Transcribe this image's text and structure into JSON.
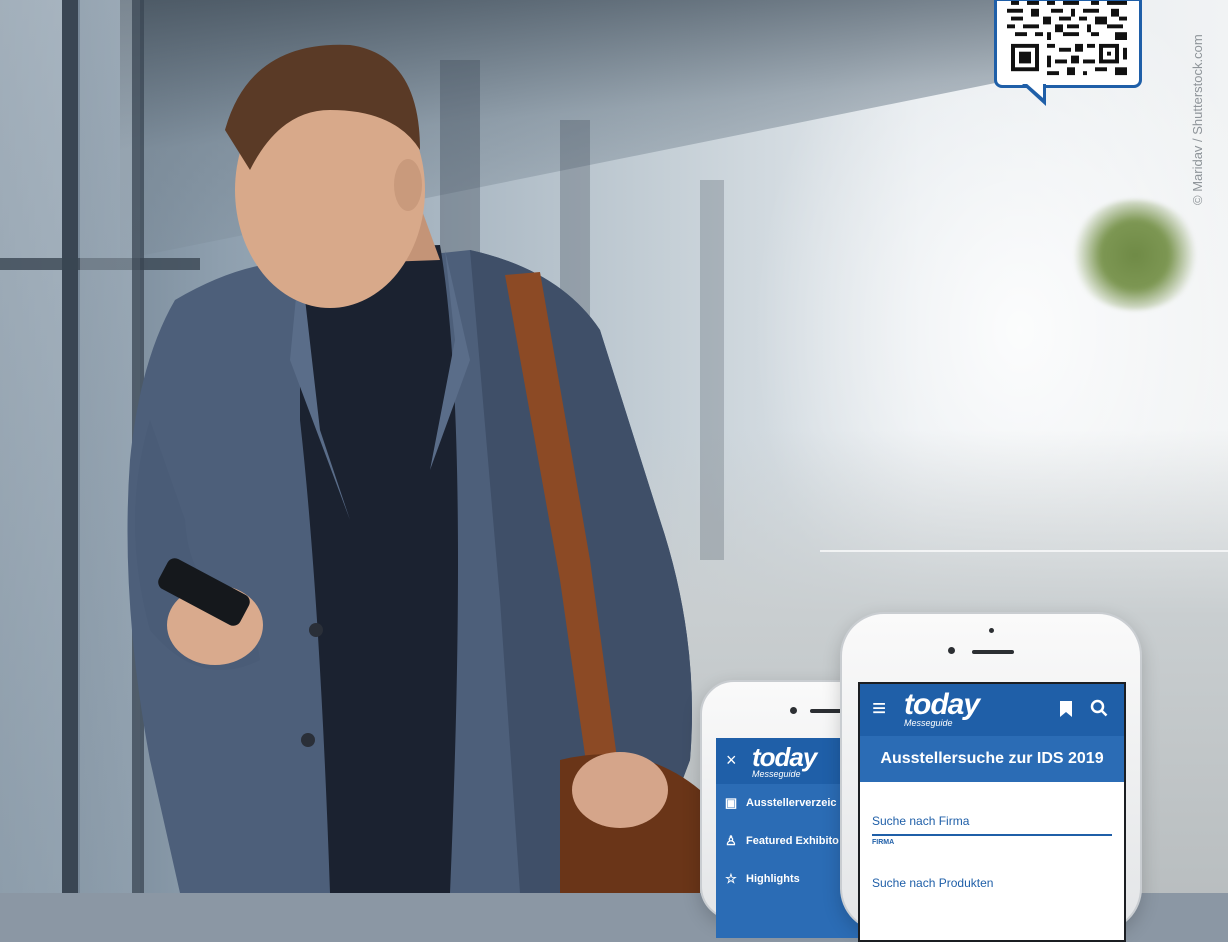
{
  "qr_code": {
    "label": "qr-code"
  },
  "photo_credit": "© Maridav / Shutterstock.com",
  "colors": {
    "brand_blue": "#1f5fa8",
    "menu_blue": "#2b6cb5"
  },
  "phone_small": {
    "close_icon": "×",
    "logo": "today",
    "logo_sub": "Messeguide",
    "menu": [
      {
        "icon": "address-book-icon",
        "glyph": "▣",
        "label": "Ausstellerverzeic"
      },
      {
        "icon": "people-star-icon",
        "glyph": "♙",
        "label": "Featured Exhibito"
      },
      {
        "icon": "star-icon",
        "glyph": "☆",
        "label": "Highlights"
      }
    ]
  },
  "phone_large": {
    "menu_icon": "≡",
    "logo": "today",
    "logo_sub": "Messeguide",
    "bookmark_icon": "bookmark-icon",
    "search_icon": "search-icon",
    "title": "Ausstellersuche zur IDS 2019",
    "field_company": {
      "placeholder": "Suche nach Firma",
      "tag": "FIRMA"
    },
    "field_products": {
      "placeholder": "Suche nach Produkten"
    }
  }
}
